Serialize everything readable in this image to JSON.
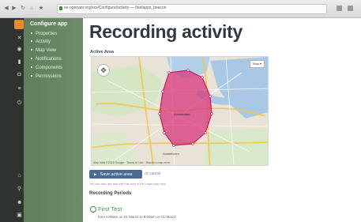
{
  "browser": {
    "url": "ee.openanr.org/xxx/Configure/activity — /teelapps_beacon"
  },
  "sidebar": {
    "title": "Configure app",
    "items": [
      {
        "label": "Properties"
      },
      {
        "label": "Activity"
      },
      {
        "label": "Map View"
      },
      {
        "label": "Notifications"
      },
      {
        "label": "Components"
      },
      {
        "label": "Permissions"
      }
    ]
  },
  "main": {
    "title": "Recording activity",
    "active_area_label": "Active Area",
    "map": {
      "type_label": "Map ▾",
      "attribution": "Map data ©2015 Google · Terms of Use · Report a map error",
      "city_labels": [
        "Amsterdam",
        "Amstelveen"
      ]
    },
    "save_button": "Save active area",
    "cancel_link": "or cancel",
    "hint": "You can also use and edit this area in the Legal map view.",
    "periods_label": "Recording Periods",
    "period": {
      "title": "First Test",
      "subtitle": "from 6:00am on 01 March to 9:00am on 01 March"
    }
  }
}
